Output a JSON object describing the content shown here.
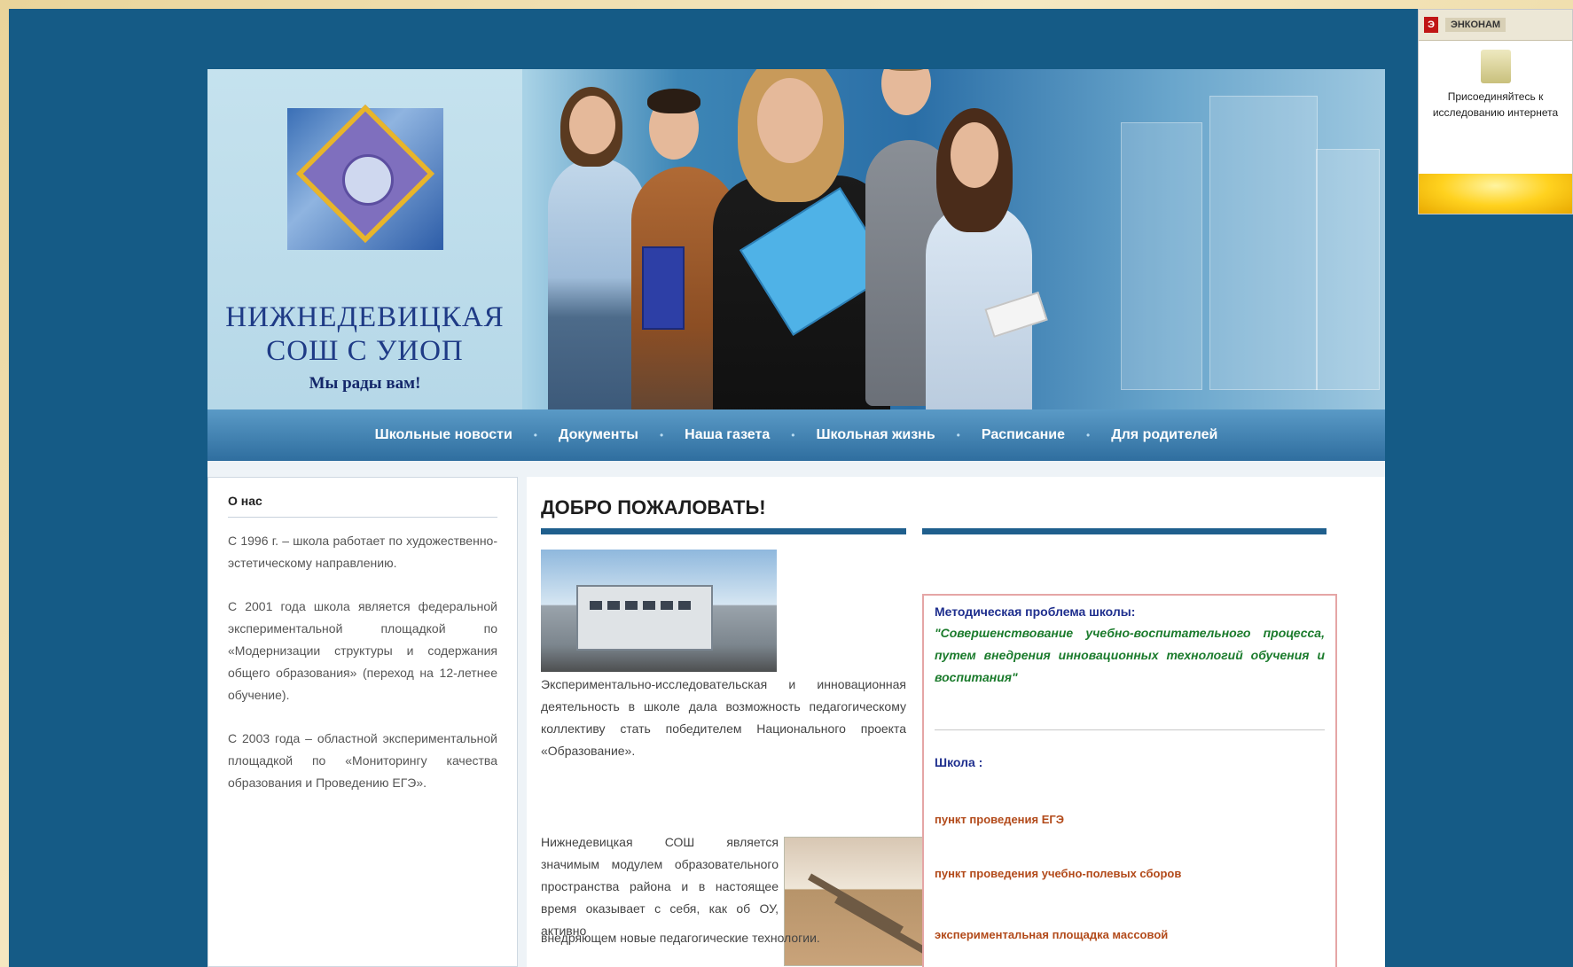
{
  "widget": {
    "title": "ЭНКОНАМ",
    "text": "Присоединяйтесь к исследованию интернета"
  },
  "header": {
    "school_name_line1": "НИЖНЕДЕВИЦКАЯ",
    "school_name_line2": "СОШ С УИОП",
    "tagline": "Мы рады вам!"
  },
  "nav": {
    "items": [
      {
        "label": "Школьные новости"
      },
      {
        "label": "Документы"
      },
      {
        "label": "Наша газета"
      },
      {
        "label": "Школьная жизнь"
      },
      {
        "label": "Расписание"
      },
      {
        "label": "Для родителей"
      }
    ],
    "separator": "•"
  },
  "sidebar": {
    "title": "О нас",
    "paragraphs": [
      "С 1996 г. – школа работает по художественно-эстетическому направлению.",
      "С 2001 года школа является федеральной экспериментальной площадкой по «Модернизации структуры и содержания общего образования» (переход на 12-летнее обучение).",
      "С 2003 года – областной экспериментальной площадкой по «Мониторингу качества образования и Проведению ЕГЭ»."
    ]
  },
  "main": {
    "welcome": "ДОБРО ПОЖАЛОВАТЬ!",
    "paragraph1": "Экспериментально-исследовательская и инновационная деятельность в школе дала возможность педагогическому коллективу стать победителем Национального проекта «Образование».",
    "paragraph2": "Нижнедевицкая СОШ является значимым модулем образовательного пространства района и в настоящее время оказывает с себя, как об ОУ, активно",
    "paragraph3": "внедряющем новые педагогические технологии."
  },
  "info_box": {
    "method_title": "Методическая проблема школы:",
    "method_text": "\"Совершенствование учебно-воспитательного процесса, путем внедрения инновационных технологий обучения и воспитания\"",
    "shtab_label": "Школа :",
    "items": [
      "пункт проведения ЕГЭ",
      "пункт проведения учебно-полевых сборов",
      "экспериментальная площадка массовой"
    ]
  },
  "colors": {
    "frame": "#155b86",
    "nav": "#2f6e9f",
    "accent_rule": "#1f5f8d",
    "method_green": "#1b7b2c",
    "item_orange": "#b24a1a"
  }
}
